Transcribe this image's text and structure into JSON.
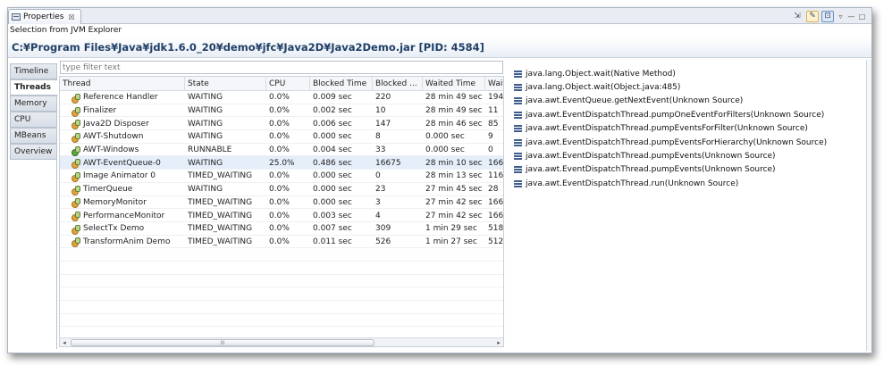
{
  "view_tab": {
    "label": "Properties",
    "close": "☒"
  },
  "selection_label": "Selection from JVM Explorer",
  "title": "C:¥Program Files¥Java¥jdk1.6.0_20¥demo¥jfc¥Java2D¥Java2Demo.jar [PID: 4584]",
  "side_tabs": [
    "Timeline",
    "Threads",
    "Memory",
    "CPU",
    "MBeans",
    "Overview"
  ],
  "active_tab": "Threads",
  "filter": {
    "placeholder": "type filter text",
    "value": ""
  },
  "columns": [
    "Thread",
    "State",
    "CPU",
    "Blocked Time",
    "Blocked ...",
    "Waited Time",
    "Waite"
  ],
  "threads": [
    {
      "name": "Reference Handler",
      "state": "WAITING",
      "cpu": "0.0%",
      "blocked_time": "0.009 sec",
      "blocked_count": "220",
      "waited_time": "28 min 49 sec",
      "waited_count": "194",
      "running": false
    },
    {
      "name": "Finalizer",
      "state": "WAITING",
      "cpu": "0.0%",
      "blocked_time": "0.002 sec",
      "blocked_count": "10",
      "waited_time": "28 min 49 sec",
      "waited_count": "11",
      "running": false
    },
    {
      "name": "Java2D Disposer",
      "state": "WAITING",
      "cpu": "0.0%",
      "blocked_time": "0.006 sec",
      "blocked_count": "147",
      "waited_time": "28 min 46 sec",
      "waited_count": "85",
      "running": false
    },
    {
      "name": "AWT-Shutdown",
      "state": "WAITING",
      "cpu": "0.0%",
      "blocked_time": "0.000 sec",
      "blocked_count": "8",
      "waited_time": "0.000 sec",
      "waited_count": "9",
      "running": false
    },
    {
      "name": "AWT-Windows",
      "state": "RUNNABLE",
      "cpu": "0.0%",
      "blocked_time": "0.004 sec",
      "blocked_count": "33",
      "waited_time": "0.000 sec",
      "waited_count": "0",
      "running": true
    },
    {
      "name": "AWT-EventQueue-0",
      "state": "WAITING",
      "cpu": "25.0%",
      "blocked_time": "0.486 sec",
      "blocked_count": "16675",
      "waited_time": "28 min 10 sec",
      "waited_count": "166",
      "running": false
    },
    {
      "name": "Image Animator 0",
      "state": "TIMED_WAITING",
      "cpu": "0.0%",
      "blocked_time": "0.000 sec",
      "blocked_count": "0",
      "waited_time": "28 min 13 sec",
      "waited_count": "116",
      "running": false
    },
    {
      "name": "TimerQueue",
      "state": "WAITING",
      "cpu": "0.0%",
      "blocked_time": "0.000 sec",
      "blocked_count": "23",
      "waited_time": "27 min 45 sec",
      "waited_count": "28",
      "running": false
    },
    {
      "name": "MemoryMonitor",
      "state": "TIMED_WAITING",
      "cpu": "0.0%",
      "blocked_time": "0.000 sec",
      "blocked_count": "3",
      "waited_time": "27 min 42 sec",
      "waited_count": "166",
      "running": false
    },
    {
      "name": "PerformanceMonitor",
      "state": "TIMED_WAITING",
      "cpu": "0.0%",
      "blocked_time": "0.003 sec",
      "blocked_count": "4",
      "waited_time": "27 min 42 sec",
      "waited_count": "166",
      "running": false
    },
    {
      "name": "SelectTx Demo",
      "state": "TIMED_WAITING",
      "cpu": "0.0%",
      "blocked_time": "0.007 sec",
      "blocked_count": "309",
      "waited_time": "1 min 29 sec",
      "waited_count": "518",
      "running": false
    },
    {
      "name": "TransformAnim Demo",
      "state": "TIMED_WAITING",
      "cpu": "0.0%",
      "blocked_time": "0.011 sec",
      "blocked_count": "526",
      "waited_time": "1 min 27 sec",
      "waited_count": "512",
      "running": false
    }
  ],
  "stack_trace": [
    "java.lang.Object.wait(Native Method)",
    "java.lang.Object.wait(Object.java:485)",
    "java.awt.EventQueue.getNextEvent(Unknown Source)",
    "java.awt.EventDispatchThread.pumpOneEventForFilters(Unknown Source)",
    "java.awt.EventDispatchThread.pumpEventsForFilter(Unknown Source)",
    "java.awt.EventDispatchThread.pumpEventsForHierarchy(Unknown Source)",
    "java.awt.EventDispatchThread.pumpEvents(Unknown Source)",
    "java.awt.EventDispatchThread.pumpEvents(Unknown Source)",
    "java.awt.EventDispatchThread.run(Unknown Source)"
  ],
  "scrollbar": {
    "thumb_grip": "III",
    "left_arrow": "◂",
    "right_arrow": "▸"
  },
  "toolbar": {
    "menu_glyph": "▿",
    "minimize_glyph": "—",
    "maximize_glyph": "□"
  }
}
